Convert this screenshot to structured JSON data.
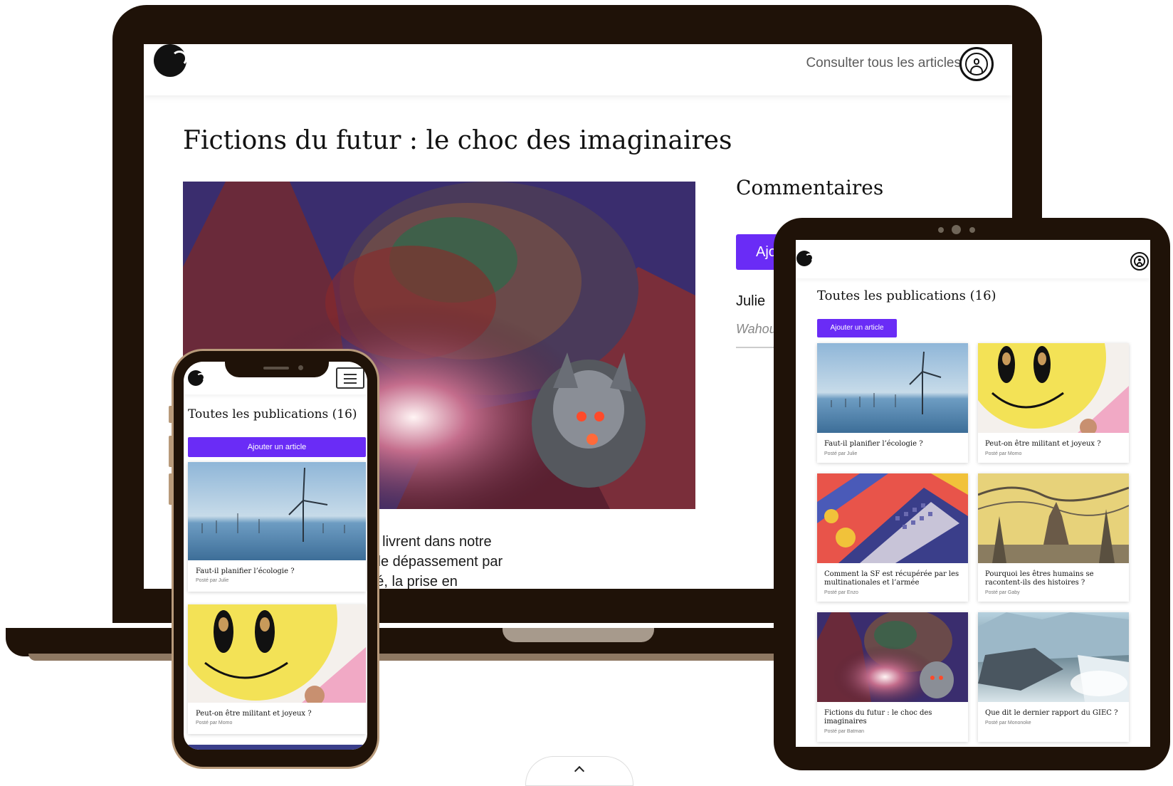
{
  "brand": {
    "accent_color": "#6a2cf6",
    "device_frame_color": "#1f1208"
  },
  "laptop": {
    "header": {
      "logo_icon": "phoenix-logo-icon",
      "nav_link": "Consulter tous les articles",
      "user_icon": "user-circle-icon"
    },
    "article": {
      "title": "Fictions du futur : le choc des imaginaires",
      "hero_image": "sci-fi-collage",
      "body_lines": [
        "es nombreuses batailles qui se livrent dans notre",
        "re elles, plus saillante, oppose le dépassement par",
        "grâce à la technologie d’un côté, la prise en"
      ]
    },
    "comments": {
      "heading": "Commentaires",
      "add_button": "Ajo",
      "items": [
        {
          "author": "Julie",
          "text": "Wahou"
        }
      ]
    }
  },
  "tablet": {
    "heading": "Toutes les publications (16)",
    "add_button": "Ajouter un article",
    "cards": [
      {
        "title": "Faut-il planifier l’écologie ?",
        "byline": "Posté par Julie",
        "image": "wind-turbines"
      },
      {
        "title": "Peut-on être militant et joyeux ?",
        "byline": "Posté par Momo",
        "image": "smiley-face"
      },
      {
        "title": "Comment la SF est récupérée par les multinationales et l’armée",
        "byline": "Posté par Enzo",
        "image": "isometric-pattern"
      },
      {
        "title": "Pourquoi les êtres humains se racontent-ils des histoires ?",
        "byline": "Posté par Gaby",
        "image": "fox-engraving"
      },
      {
        "title": "Fictions du futur : le choc des imaginaires",
        "byline": "Posté par Batman",
        "image": "sci-fi-collage"
      },
      {
        "title": "Que dit le dernier rapport du GIEC ?",
        "byline": "Posté par Mononoke",
        "image": "glacier"
      }
    ]
  },
  "phone": {
    "heading": "Toutes les publications (16)",
    "add_button": "Ajouter un article",
    "menu_icon": "hamburger-menu-icon",
    "cards": [
      {
        "title": "Faut-il planifier l’écologie ?",
        "byline": "Posté par Julie",
        "image": "wind-turbines"
      },
      {
        "title": "Peut-on être militant et joyeux ?",
        "byline": "Posté par Momo",
        "image": "smiley-face"
      }
    ]
  },
  "scroll_button_icon": "chevron-up-icon"
}
